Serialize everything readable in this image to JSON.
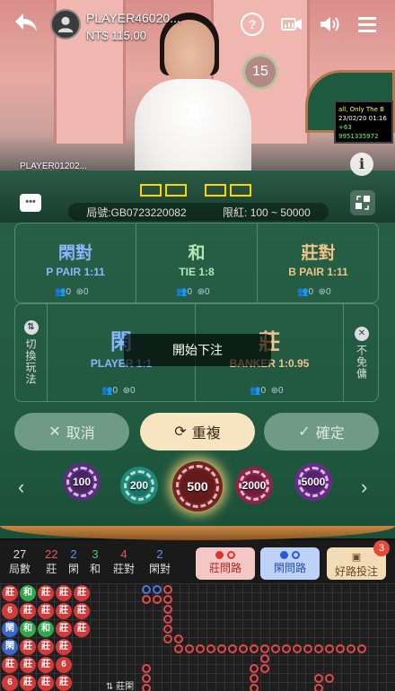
{
  "header": {
    "player_name": "PLAYER46020...",
    "balance": "NT$ 115.00",
    "timer": "15"
  },
  "video": {
    "other_player": "PLAYER01202...",
    "round_label": "局號:GB0723220082",
    "limit_label": "限紅: 100 ~ 50000",
    "monitor_lines": [
      "all, Only The B",
      "23/02/20  01:16",
      "+63 9951335972"
    ]
  },
  "bets": {
    "player_pair": {
      "title": "閑對",
      "odds": "P PAIR 1:11",
      "stat_a": "0",
      "stat_b": "0"
    },
    "tie": {
      "title": "和",
      "odds": "TIE 1:8",
      "stat_a": "0",
      "stat_b": "0"
    },
    "banker_pair": {
      "title": "莊對",
      "odds": "B PAIR 1:11",
      "stat_a": "0",
      "stat_b": "0"
    },
    "player": {
      "title": "閑",
      "odds": "PLAYER 1:1",
      "stat_a": "0",
      "stat_b": "0"
    },
    "banker": {
      "title": "莊",
      "odds": "BANKER 1:0.95",
      "stat_a": "0",
      "stat_b": "0"
    },
    "switch_label": "切換玩法",
    "no_commission_label": "不免傭",
    "toast": "開始下注"
  },
  "actions": {
    "cancel": "取消",
    "repeat": "重複",
    "confirm": "確定"
  },
  "chips": [
    {
      "value": "100",
      "color": "#5b2d7e"
    },
    {
      "value": "200",
      "color": "#1f8a7a"
    },
    {
      "value": "500",
      "color": "#7a2222"
    },
    {
      "value": "2000",
      "color": "#8a2448"
    },
    {
      "value": "5000",
      "color": "#6b2a8a"
    }
  ],
  "stats": {
    "rounds": {
      "num": "27",
      "label": "局數"
    },
    "banker": {
      "num": "22",
      "label": "莊"
    },
    "player": {
      "num": "2",
      "label": "閑"
    },
    "tie": {
      "num": "3",
      "label": "和"
    },
    "banker_pair": {
      "num": "4",
      "label": "莊對"
    },
    "player_pair": {
      "num": "2",
      "label": "閑對"
    }
  },
  "road_buttons": {
    "banker_ask": "莊問路",
    "player_ask": "閑問路",
    "good_road": "好路投注",
    "good_road_badge": "3"
  },
  "roadmap": {
    "bead_rows": [
      [
        "莊",
        "和",
        "莊",
        "莊",
        "莊"
      ],
      [
        "6",
        "莊",
        "莊",
        "莊",
        "莊"
      ],
      [
        "閑",
        "和",
        "和",
        "莊",
        "莊"
      ],
      [
        "閑",
        "莊",
        "莊",
        "莊",
        ""
      ],
      [
        "莊",
        "莊",
        "莊",
        "6",
        ""
      ],
      [
        "6",
        "莊",
        "莊",
        "莊",
        ""
      ]
    ],
    "bottom_label": "⇅ 莊閑"
  },
  "colors": {
    "banker": "#d33a3a",
    "player": "#3a67c9",
    "tie": "#2fa84a",
    "felt": "#265f46"
  }
}
